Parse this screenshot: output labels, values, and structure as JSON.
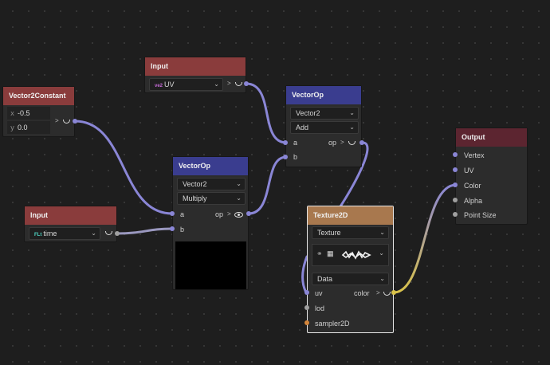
{
  "colors": {
    "canvas_bg": "#1e1e1e",
    "header_input": "#8a3c3c",
    "header_vectorop": "#3a3d8f",
    "header_output": "#5c2530",
    "header_texture": "#a8784e",
    "wire_purple": "#8a86d6",
    "wire_gray": "#a0a0a0",
    "wire_yellow": "#d9c24a"
  },
  "nodes": {
    "input_uv": {
      "title": "Input",
      "badge": "ve2",
      "value": "UV",
      "expand_glyph": ">"
    },
    "vector2const": {
      "title": "Vector2Constant",
      "x_label": "x",
      "x_value": "-0.5",
      "y_label": "y",
      "y_value": "0.0",
      "expand_glyph": ">"
    },
    "input_time": {
      "title": "Input",
      "badge": "FLt",
      "value": "time"
    },
    "vectorop_top": {
      "title": "VectorOp",
      "type": "Vector2",
      "op": "Add",
      "in_a": "a",
      "in_b": "b",
      "out_op": "op",
      "expand_glyph": ">"
    },
    "vectorop_mid": {
      "title": "VectorOp",
      "type": "Vector2",
      "op": "Multiply",
      "in_a": "a",
      "in_b": "b",
      "out_op": "op",
      "expand_glyph": ">"
    },
    "texture2d": {
      "title": "Texture2D",
      "type": "Texture",
      "mode": "Data",
      "in_uv": "uv",
      "in_lod": "lod",
      "in_sampler": "sampler2D",
      "out_color": "color",
      "expand_glyph": ">"
    },
    "output": {
      "title": "Output",
      "ports": [
        "Vertex",
        "UV",
        "Color",
        "Alpha",
        "Point Size"
      ]
    }
  },
  "icons": {
    "dropdown": "chevron-down-icon",
    "preview_toggle": "eye-icon",
    "link_indicator": "smile-link-icon"
  }
}
